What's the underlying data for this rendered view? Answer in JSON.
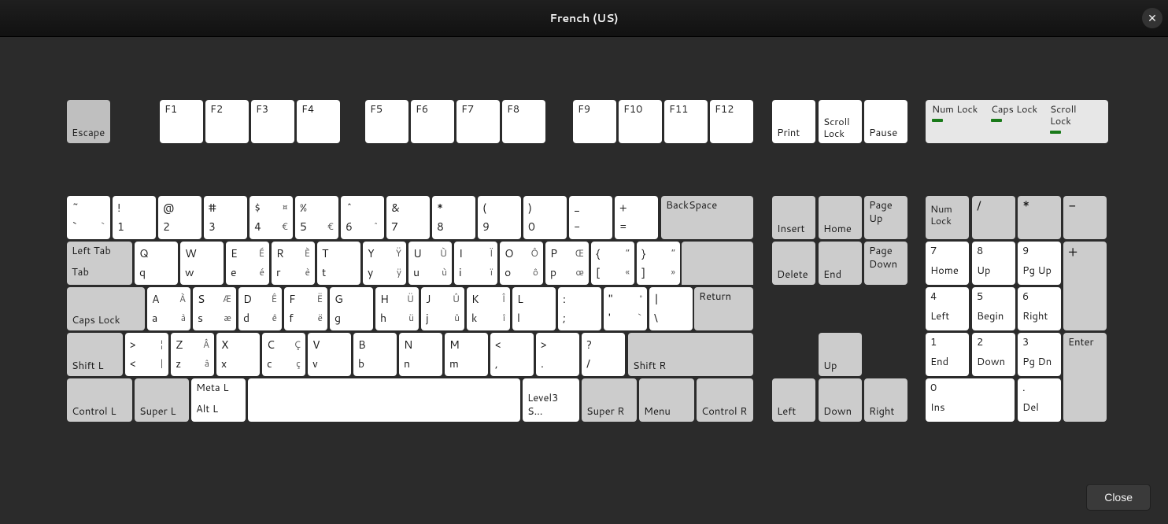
{
  "window": {
    "title": "French (US)"
  },
  "buttons": {
    "close": "Close"
  },
  "indicators": {
    "num": "Num Lock",
    "caps": "Caps Lock",
    "scroll": "Scroll Lock"
  },
  "fn_row": {
    "esc": "Escape",
    "f": [
      "F1",
      "F2",
      "F3",
      "F4",
      "F5",
      "F6",
      "F7",
      "F8",
      "F9",
      "F10",
      "F11",
      "F12"
    ],
    "print": "Print",
    "scroll": "Scroll Lock",
    "pause": "Pause"
  },
  "row_num": {
    "keys": [
      {
        "tl": "~",
        "tr": "",
        "bl": "`",
        "br": "`"
      },
      {
        "tl": "!",
        "tr": "",
        "bl": "1",
        "br": ""
      },
      {
        "tl": "@",
        "tr": "",
        "bl": "2",
        "br": ""
      },
      {
        "tl": "#",
        "tr": "",
        "bl": "3",
        "br": ""
      },
      {
        "tl": "$",
        "tr": "¤",
        "bl": "4",
        "br": "€"
      },
      {
        "tl": "%",
        "tr": "",
        "bl": "5",
        "br": "€"
      },
      {
        "tl": "^",
        "tr": "",
        "bl": "6",
        "br": "^"
      },
      {
        "tl": "&",
        "tr": "",
        "bl": "7",
        "br": ""
      },
      {
        "tl": "*",
        "tr": "",
        "bl": "8",
        "br": ""
      },
      {
        "tl": "(",
        "tr": "",
        "bl": "9",
        "br": ""
      },
      {
        "tl": ")",
        "tr": "",
        "bl": "0",
        "br": ""
      },
      {
        "tl": "_",
        "tr": "",
        "bl": "-",
        "br": ""
      },
      {
        "tl": "+",
        "tr": "",
        "bl": "=",
        "br": ""
      }
    ],
    "backspace": "BackSpace"
  },
  "row_q": {
    "tab_top": "Left Tab",
    "tab_bot": "Tab",
    "keys": [
      {
        "tl": "Q",
        "tr": "",
        "bl": "q",
        "br": ""
      },
      {
        "tl": "W",
        "tr": "",
        "bl": "w",
        "br": ""
      },
      {
        "tl": "E",
        "tr": "É",
        "bl": "e",
        "br": "é"
      },
      {
        "tl": "R",
        "tr": "È",
        "bl": "r",
        "br": "è"
      },
      {
        "tl": "T",
        "tr": "",
        "bl": "t",
        "br": ""
      },
      {
        "tl": "Y",
        "tr": "Ÿ",
        "bl": "y",
        "br": "ÿ"
      },
      {
        "tl": "U",
        "tr": "Ù",
        "bl": "u",
        "br": "ù"
      },
      {
        "tl": "I",
        "tr": "Ï",
        "bl": "i",
        "br": "ï"
      },
      {
        "tl": "O",
        "tr": "Ô",
        "bl": "o",
        "br": "ô"
      },
      {
        "tl": "P",
        "tr": "Œ",
        "bl": "p",
        "br": "œ"
      },
      {
        "tl": "{",
        "tr": "“",
        "bl": "[",
        "br": "«"
      },
      {
        "tl": "}",
        "tr": "”",
        "bl": "]",
        "br": "»"
      }
    ]
  },
  "row_a": {
    "caps": "Caps Lock",
    "keys": [
      {
        "tl": "A",
        "tr": "À",
        "bl": "a",
        "br": "à"
      },
      {
        "tl": "S",
        "tr": "Æ",
        "bl": "s",
        "br": "æ"
      },
      {
        "tl": "D",
        "tr": "Ê",
        "bl": "d",
        "br": "ê"
      },
      {
        "tl": "F",
        "tr": "Ë",
        "bl": "f",
        "br": "ë"
      },
      {
        "tl": "G",
        "tr": "",
        "bl": "g",
        "br": ""
      },
      {
        "tl": "H",
        "tr": "Ü",
        "bl": "h",
        "br": "ü"
      },
      {
        "tl": "J",
        "tr": "Û",
        "bl": "j",
        "br": "û"
      },
      {
        "tl": "K",
        "tr": "Î",
        "bl": "k",
        "br": "î"
      },
      {
        "tl": "L",
        "tr": "",
        "bl": "l",
        "br": ""
      },
      {
        "tl": ":",
        "tr": "",
        "bl": ";",
        "br": ""
      },
      {
        "tl": "\"",
        "tr": "°",
        "bl": "'",
        "br": "`"
      },
      {
        "tl": "|",
        "tr": "",
        "bl": "\\",
        "br": ""
      }
    ],
    "return": "Return"
  },
  "row_z": {
    "shift_l": "Shift L",
    "extra": {
      "tl": ">",
      "tr": "¦",
      "bl": "<",
      "br": "|"
    },
    "keys": [
      {
        "tl": "Z",
        "tr": "Â",
        "bl": "z",
        "br": "â"
      },
      {
        "tl": "X",
        "tr": "",
        "bl": "x",
        "br": ""
      },
      {
        "tl": "C",
        "tr": "Ç",
        "bl": "c",
        "br": "ç"
      },
      {
        "tl": "V",
        "tr": "",
        "bl": "v",
        "br": ""
      },
      {
        "tl": "B",
        "tr": "",
        "bl": "b",
        "br": ""
      },
      {
        "tl": "N",
        "tr": "",
        "bl": "n",
        "br": ""
      },
      {
        "tl": "M",
        "tr": "",
        "bl": "m",
        "br": ""
      },
      {
        "tl": "<",
        "tr": "",
        "bl": ",",
        "br": ""
      },
      {
        "tl": ">",
        "tr": "",
        "bl": ".",
        "br": ""
      },
      {
        "tl": "?",
        "tr": "",
        "bl": "/",
        "br": ""
      }
    ],
    "shift_r": "Shift R"
  },
  "row_bottom": {
    "ctrl_l": "Control L",
    "super_l": "Super L",
    "meta_top": "Meta L",
    "meta_bot": "Alt L",
    "level3": "Level3 S…",
    "super_r": "Super R",
    "menu": "Menu",
    "ctrl_r": "Control R"
  },
  "nav": {
    "insert": "Insert",
    "home": "Home",
    "pgup_top": "Page",
    "pgup_bot": "Up",
    "delete": "Delete",
    "end": "End",
    "pgdn_top": "Page",
    "pgdn_bot": "Down",
    "up": "Up",
    "left": "Left",
    "down": "Down",
    "right": "Right"
  },
  "numpad": {
    "numlock": "Num Lock",
    "div": "/",
    "mul": "*",
    "sub": "-",
    "7t": "7",
    "7b": "Home",
    "8t": "8",
    "8b": "Up",
    "9t": "9",
    "9b": "Pg Up",
    "add": "+",
    "4t": "4",
    "4b": "Left",
    "5t": "5",
    "5b": "Begin",
    "6t": "6",
    "6b": "Right",
    "1t": "1",
    "1b": "End",
    "2t": "2",
    "2b": "Down",
    "3t": "3",
    "3b": "Pg Dn",
    "enter": "Enter",
    "0t": "0",
    "0b": "Ins",
    "dt": ".",
    "db": "Del"
  }
}
